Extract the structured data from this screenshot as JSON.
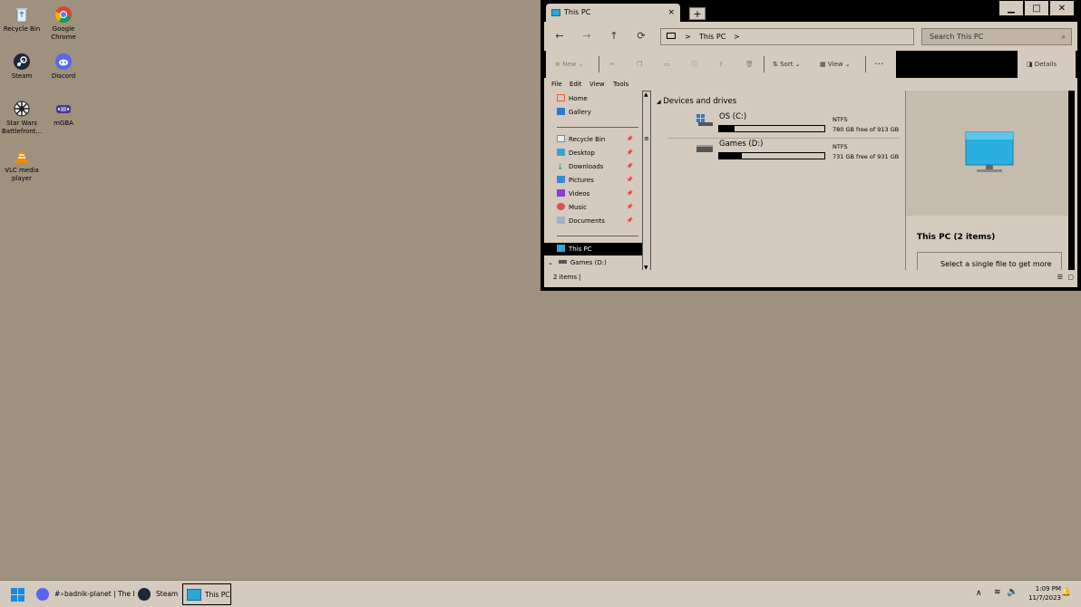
{
  "desktop": {
    "icons": [
      {
        "label": "Recycle Bin",
        "icon": "recycle-bin-icon"
      },
      {
        "label": "Google Chrome",
        "icon": "chrome-icon"
      },
      {
        "label": "Steam",
        "icon": "steam-icon"
      },
      {
        "label": "Discord",
        "icon": "discord-icon"
      },
      {
        "label": "Star Wars Battlefront...",
        "icon": "star-wars-icon"
      },
      {
        "label": "mGBA",
        "icon": "mgba-icon"
      },
      {
        "label": "VLC media player",
        "icon": "vlc-icon"
      }
    ]
  },
  "window": {
    "tab_title": "This PC",
    "tab_close": "×",
    "new_tab": "+",
    "controls": {
      "minimize": "▁",
      "maximize": "□",
      "close": "✕"
    },
    "nav": {
      "back": "←",
      "forward": "→",
      "up": "↑",
      "refresh": "⟳"
    },
    "address": {
      "separator": ">",
      "location": "This PC",
      "trail": ">"
    },
    "search_placeholder": "Search This PC",
    "toolbar": {
      "new": "New",
      "sort": "Sort",
      "view": "View",
      "more": "···",
      "details": "Details"
    },
    "menu": {
      "file": "File",
      "edit": "Edit",
      "view": "View",
      "tools": "Tools"
    },
    "nav_pane": {
      "quick": [
        {
          "label": "Home"
        },
        {
          "label": "Gallery"
        }
      ],
      "pinned": [
        {
          "label": "Recycle Bin"
        },
        {
          "label": "Desktop"
        },
        {
          "label": "Downloads"
        },
        {
          "label": "Pictures"
        },
        {
          "label": "Videos"
        },
        {
          "label": "Music"
        },
        {
          "label": "Documents"
        }
      ],
      "this_pc": "This PC",
      "games": "Games (D:)"
    },
    "section": "Devices and drives",
    "drives": [
      {
        "name": "OS (C:)",
        "fs": "NTFS",
        "free": "780 GB free of 913 GB",
        "used_fraction": 0.146
      },
      {
        "name": "Games (D:)",
        "fs": "NTFS",
        "free": "731 GB free of 931 GB",
        "used_fraction": 0.215
      }
    ],
    "details_pane": {
      "title": "This PC (2 items)",
      "hint": "Select a single file to get more"
    },
    "status": "2 items"
  },
  "taskbar": {
    "items": [
      {
        "label": "#∘badnik-planet | The I"
      },
      {
        "label": "Steam"
      },
      {
        "label": "This PC"
      }
    ],
    "time": "1:09 PM",
    "date": "11/7/2023"
  },
  "colors": {
    "desktop": "#9e917d",
    "window": "#d4cabd",
    "accent": "#2aa7d8"
  }
}
